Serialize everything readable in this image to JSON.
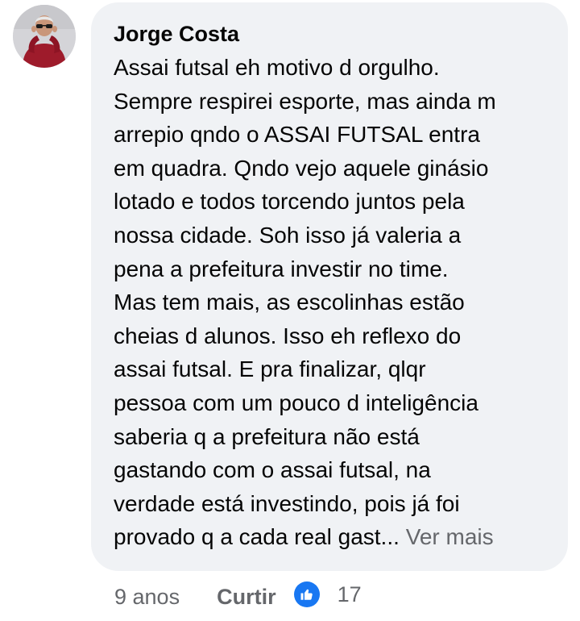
{
  "comment": {
    "author": "Jorge Costa",
    "lines": [
      "Assai futsal eh motivo d orgulho.",
      "Sempre respirei esporte, mas ainda m",
      "arrepio qndo o ASSAI FUTSAL entra",
      "em quadra. Qndo vejo aquele ginásio",
      "lotado e todos torcendo juntos pela",
      "nossa cidade. Soh isso já valeria a",
      "pena a prefeitura investir no time.",
      "Mas tem mais, as escolinhas  estão",
      "cheias d alunos. Isso eh reflexo do",
      "assai futsal. E pra finalizar, qlqr",
      "pessoa com um pouco d inteligência",
      "saberia q a prefeitura não está",
      "gastando com o assai futsal, na",
      "verdade está investindo, pois já foi",
      "provado q a cada real gast..."
    ],
    "see_more": "Ver mais"
  },
  "footer": {
    "time": "9 anos",
    "like_label": "Curtir",
    "like_count": "17",
    "like_color": "#1877f2"
  },
  "icons": {
    "avatar": "user-avatar",
    "reaction": "thumbs-up-icon"
  }
}
